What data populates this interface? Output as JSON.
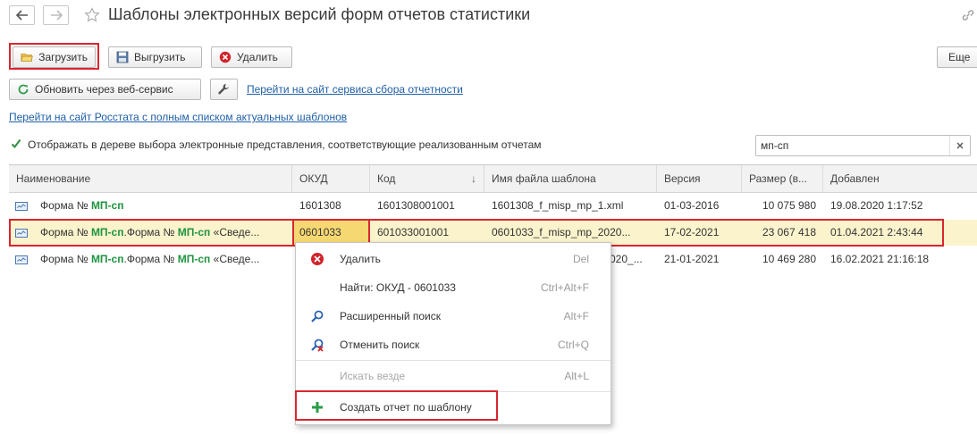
{
  "nav": {
    "back_icon": "arrow-left-icon",
    "forward_icon": "arrow-right-icon",
    "favorite_icon": "star-icon"
  },
  "page": {
    "title": "Шаблоны электронных версий форм отчетов статистики",
    "link_icon": "link-icon"
  },
  "toolbar1": {
    "load_label": "Загрузить",
    "unload_label": "Выгрузить",
    "delete_label": "Удалить",
    "more_label": "Еще"
  },
  "toolbar2": {
    "refresh_label": "Обновить через веб-сервис",
    "service_link": "Перейти на сайт сервиса сбора отчетности"
  },
  "rosstat_link": "Перейти на сайт Росстата с полным списком актуальных шаблонов",
  "filter": {
    "checkbox_label": "Отображать в дереве выбора электронные представления, соответствующие реализованным отчетам",
    "checked": true,
    "search_value": "мп-сп",
    "clear_icon": "close-icon"
  },
  "table": {
    "columns": [
      "Наименование",
      "ОКУД",
      "Код",
      "Имя файла шаблона",
      "Версия",
      "Размер (в...",
      "Добавлен"
    ],
    "sort_indicator": "↓",
    "rows": [
      {
        "name_prefix": "Форма № ",
        "name_hl1": "МП-сп",
        "name_mid": "",
        "name_hl2": "",
        "name_suffix": "",
        "okud": "1601308",
        "code": "1601308001001",
        "file": "1601308_f_misp_mp_1.xml",
        "version": "01-03-2016",
        "size": "10 075 980",
        "added": "19.08.2020 1:17:52"
      },
      {
        "name_prefix": "Форма № ",
        "name_hl1": "МП-сп",
        "name_mid": ".Форма № ",
        "name_hl2": "МП-сп",
        "name_suffix": " «Сведе...",
        "okud": "0601033",
        "code": "601033001001",
        "file": "0601033_f_misp_mp_2020...",
        "version": "17-02-2021",
        "size": "23 067 418",
        "added": "01.04.2021 2:43:44"
      },
      {
        "name_prefix": "Форма № ",
        "name_hl1": "МП-сп",
        "name_mid": ".Форма № ",
        "name_hl2": "МП-сп",
        "name_suffix": " «Сведе...",
        "okud": "",
        "code": "",
        "file": "020_...",
        "version": "21-01-2021",
        "size": "10 469 280",
        "added": "16.02.2021 21:16:18"
      }
    ]
  },
  "context_menu": {
    "items": [
      {
        "label": "Удалить",
        "shortcut": "Del",
        "icon": "delete-icon"
      },
      {
        "label": "Найти: ОКУД - 0601033",
        "shortcut": "Ctrl+Alt+F",
        "icon": ""
      },
      {
        "label": "Расширенный поиск",
        "shortcut": "Alt+F",
        "icon": "search-icon"
      },
      {
        "label": "Отменить поиск",
        "shortcut": "Ctrl+Q",
        "icon": "cancel-search-icon"
      },
      {
        "label": "Искать везде",
        "shortcut": "Alt+L",
        "icon": ""
      },
      {
        "label": "Создать отчет по шаблону",
        "shortcut": "",
        "icon": "plus-icon"
      }
    ]
  },
  "colors": {
    "accent_green": "#1e9440",
    "highlight_row": "#fbf3cc",
    "selected_cell": "#f6d872",
    "red_outline": "#d9262f",
    "link": "#1f5fa6"
  }
}
